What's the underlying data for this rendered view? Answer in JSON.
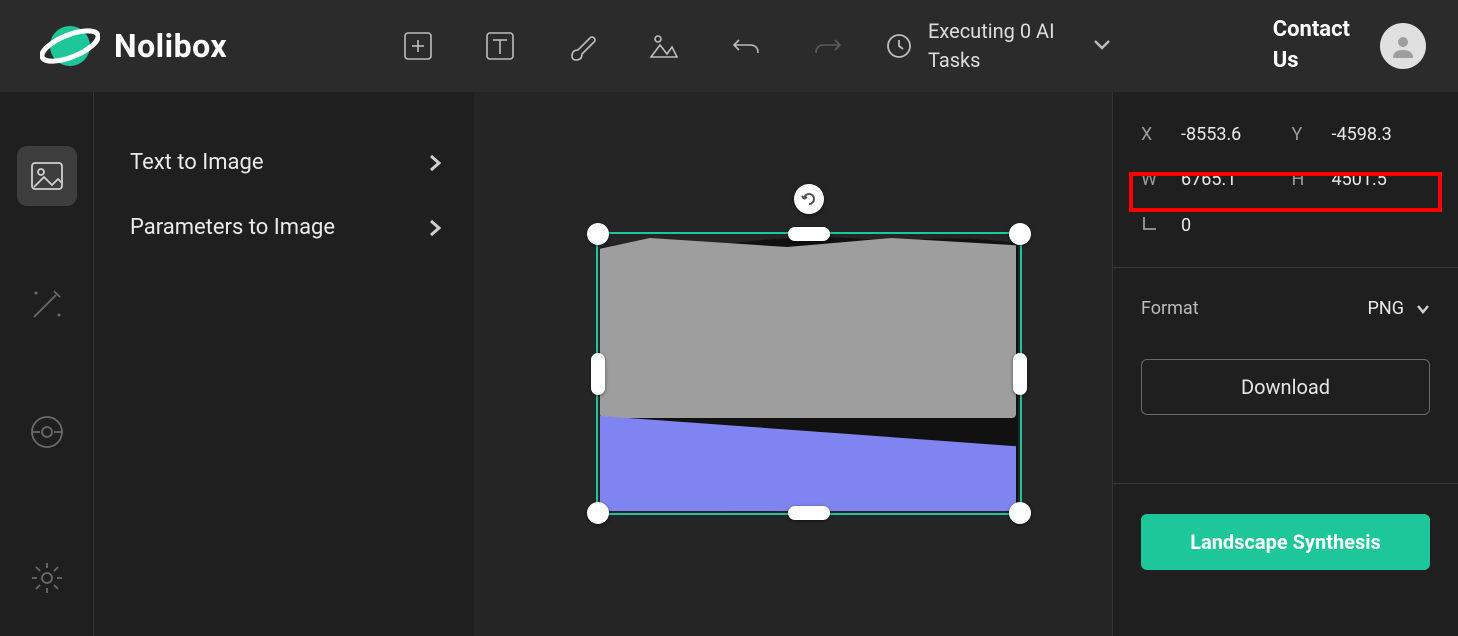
{
  "brand": {
    "name": "Nolibox"
  },
  "topbar": {
    "tasks_line1": "Executing 0 AI",
    "tasks_line2": "Tasks",
    "contact_line1": "Contact",
    "contact_line2": "Us"
  },
  "sidemenu": {
    "items": [
      {
        "label": "Text to Image"
      },
      {
        "label": "Parameters to Image"
      }
    ]
  },
  "props": {
    "x_label": "X",
    "x": "-8553.6",
    "y_label": "Y",
    "y": "-4598.3",
    "w_label": "W",
    "w": "6765.1",
    "h_label": "H",
    "h": "4501.5",
    "rot_label": "⌐",
    "rot": "0",
    "format_label": "Format",
    "format_value": "PNG",
    "download": "Download",
    "landscape_btn": "Landscape Synthesis"
  }
}
